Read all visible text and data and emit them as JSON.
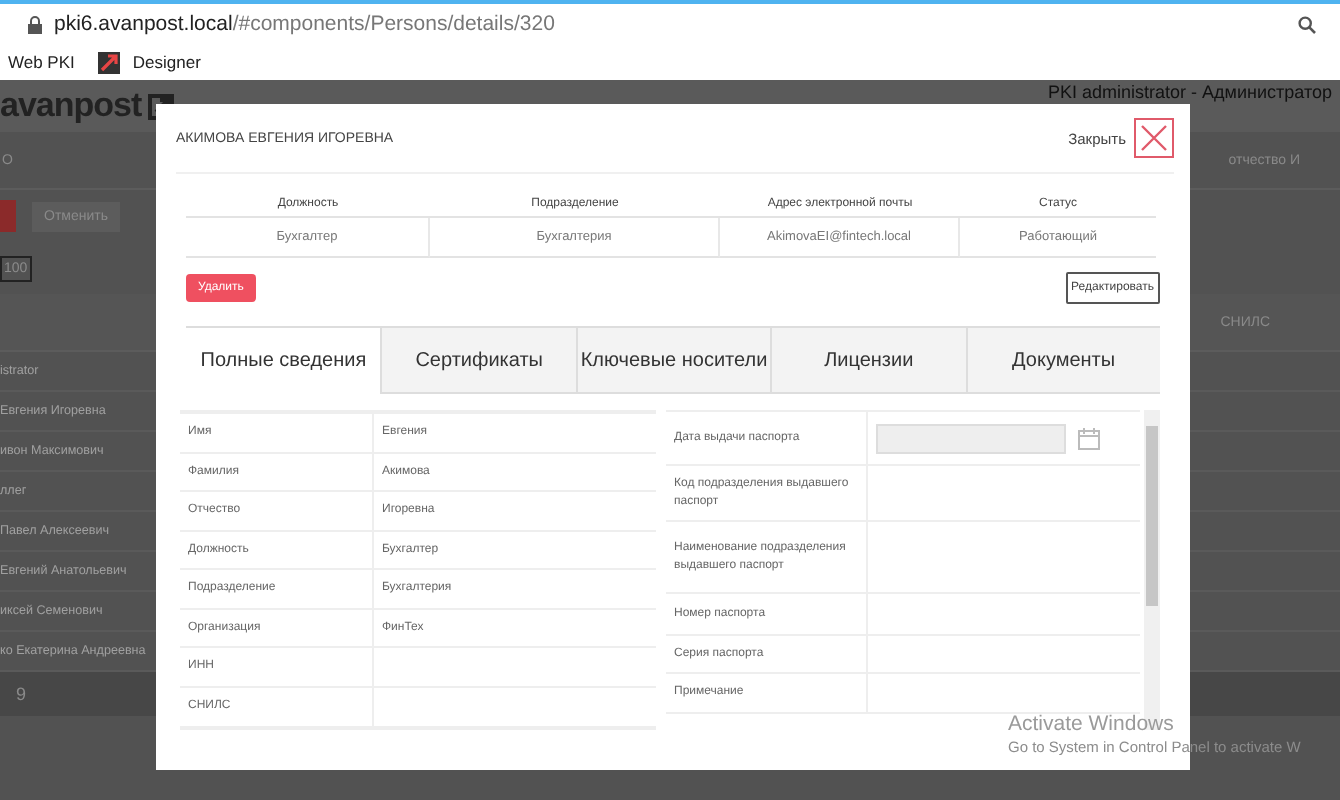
{
  "browser": {
    "url_host": "pki6.avanpost.local",
    "url_path": "/#components/Persons/details/320",
    "bookmarks": [
      {
        "label": "Web PKI",
        "kind": "plain"
      },
      {
        "label": "Designer",
        "kind": "logo"
      }
    ]
  },
  "background": {
    "logo": "avanpost",
    "user": "PKI administrator - Администратор",
    "filter_value": "О",
    "cancel_button": "Отменить",
    "page_size": "100",
    "right_header": "отчество И",
    "right_column": "СНИЛС",
    "page_number": "9",
    "names": [
      "istrator",
      "Евгения Игоревна",
      "ивон Максимович",
      "ллег",
      "Павел Алексеевич",
      "Евгений Анатольевич",
      "иксей Семенович",
      "ко Екатерина Андреевна"
    ]
  },
  "modal": {
    "title": "АКИМОВА ЕВГЕНИЯ ИГОРЕВНА",
    "close_label": "Закрыть",
    "summary": {
      "columns": [
        "Должность",
        "Подразделение",
        "Адрес электронной почты",
        "Статус"
      ],
      "values": [
        "Бухгалтер",
        "Бухгалтерия",
        "AkimovaEI@fintech.local",
        "Работающий"
      ]
    },
    "delete_button": "Удалить",
    "edit_button": "Редактировать",
    "tabs": [
      {
        "label": "Полные сведения",
        "selected": true
      },
      {
        "label": "Сертификаты",
        "selected": false
      },
      {
        "label": "Ключевые носители",
        "selected": false
      },
      {
        "label": "Лицензии",
        "selected": false
      },
      {
        "label": "Документы",
        "selected": false
      }
    ],
    "fields": [
      {
        "label": "Имя",
        "value": "Евгения"
      },
      {
        "label": "Фамилия",
        "value": "Акимова"
      },
      {
        "label": "Отчество",
        "value": "Игоревна"
      },
      {
        "label": "Должность",
        "value": "Бухгалтер"
      },
      {
        "label": "Подразделение",
        "value": "Бухгалтерия"
      },
      {
        "label": "Организация",
        "value": "ФинТех"
      },
      {
        "label": "ИНН"
      },
      {
        "label": "СНИЛС"
      }
    ],
    "passport_fields": [
      {
        "label": "Дата выдачи паспорта",
        "kind": "date"
      },
      {
        "label": "Код подразделения выдавшего паспорт",
        "kind": "text"
      },
      {
        "label": "Наименование подразделения выдавшего паспорт",
        "kind": "text"
      },
      {
        "label": "Номер паспорта",
        "kind": "text"
      },
      {
        "label": "Серия паспорта",
        "kind": "text"
      },
      {
        "label": "Примечание",
        "kind": "text"
      }
    ]
  },
  "os_notice": {
    "title": "Activate Windows",
    "text": "Go to System in Control Panel to activate W"
  }
}
